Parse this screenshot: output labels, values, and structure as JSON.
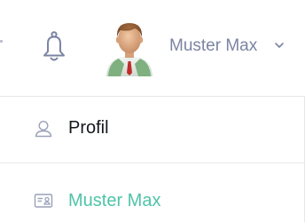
{
  "header": {
    "user_name": "Muster Max",
    "icons": {
      "bell": "bell-icon",
      "avatar": "avatar",
      "chevron": "chevron-down-icon"
    }
  },
  "menu": {
    "items": [
      {
        "label": "Profil",
        "icon": "user-icon",
        "color": "#15171d"
      },
      {
        "label": "Muster Max",
        "icon": "id-card-icon",
        "color": "#4fc3a9"
      }
    ]
  },
  "colors": {
    "muted_text": "#7c84a3",
    "accent": "#4fc3a9",
    "divider": "#e6e7ec"
  }
}
